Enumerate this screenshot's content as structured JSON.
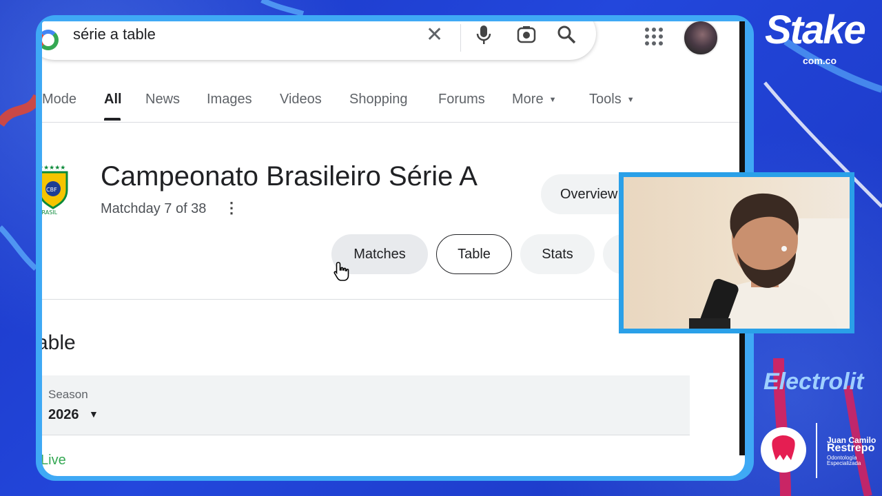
{
  "search": {
    "query": "série a table"
  },
  "tabs": [
    {
      "label": "Mode"
    },
    {
      "label": "All"
    },
    {
      "label": "News"
    },
    {
      "label": "Images"
    },
    {
      "label": "Videos"
    },
    {
      "label": "Shopping"
    },
    {
      "label": "Forums"
    },
    {
      "label": "More"
    },
    {
      "label": "Tools"
    }
  ],
  "competition": {
    "logo_text": "BRASIL",
    "title": "Campeonato Brasileiro Série A",
    "matchday": "Matchday 7 of 38"
  },
  "chips": {
    "overview": "Overview",
    "matches": "Matches",
    "table": "Table",
    "stats": "Stats"
  },
  "table_section": {
    "title": "able",
    "season_label": "Season",
    "season_value": "2026",
    "live_label": "Live"
  },
  "sponsors": {
    "stake": "Stake",
    "stake_domain": "com.co",
    "electrolit": "Electrolit",
    "jcr_first": "Juan Camilo",
    "jcr_last": "Restrepo",
    "jcr_line1": "Odontología",
    "jcr_line2": "Especializada"
  },
  "colors": {
    "background": "#1f3fd1",
    "frame": "#3fa9f5",
    "live": "#34a853"
  }
}
